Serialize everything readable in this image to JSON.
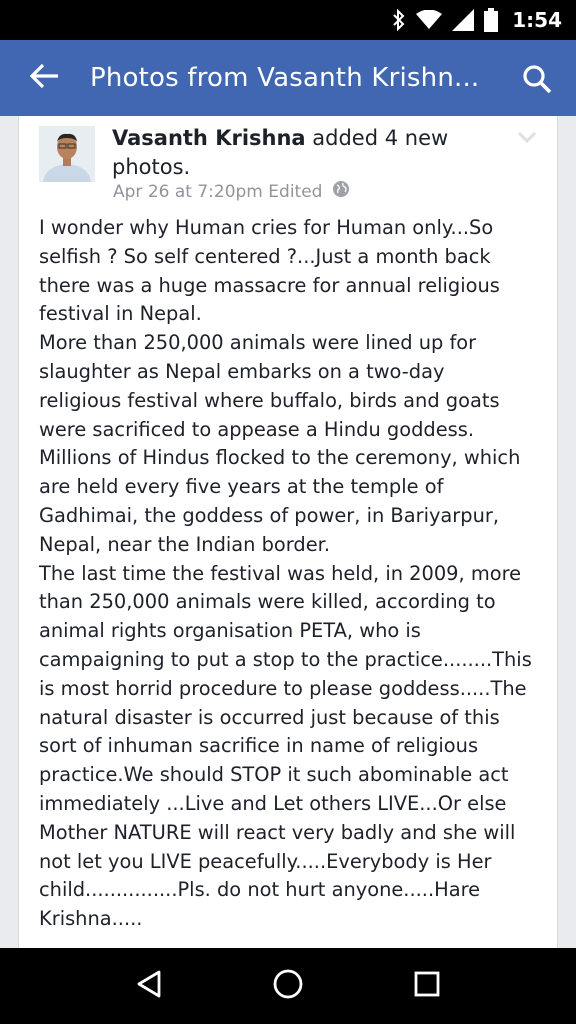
{
  "status_bar": {
    "time": "1:54",
    "icons": [
      "bluetooth-icon",
      "wifi-icon",
      "cell-signal-icon",
      "battery-icon"
    ]
  },
  "app_bar": {
    "title": "Photos from Vasanth Krishn...",
    "back_icon": "arrow-left-icon",
    "search_icon": "search-icon",
    "color": "#4267b2"
  },
  "post": {
    "author": "Vasanth Krishna",
    "action": " added 4 new photos.",
    "timestamp": "Apr 26 at 7:20pm",
    "edited": "Edited",
    "privacy_icon": "globe-icon",
    "body_lines": [
      "I wonder why Human cries for Human only...So",
      "selfish ? So self centered ?...Just a month back",
      "there was a huge massacre for annual religious",
      "festival in Nepal.",
      "More than 250,000 animals were lined up for",
      "slaughter as Nepal embarks on a two-day",
      "religious festival where buffalo, birds and goats",
      "were sacrificed to appease a Hindu goddess.",
      "Millions of Hindus flocked to the ceremony, which",
      "are held every five years at the temple of",
      "Gadhimai, the goddess of power, in Bariyarpur,",
      "Nepal, near the Indian border.",
      "The last time the festival was held, in 2009, more",
      "than 250,000 animals were killed, according to",
      "animal rights organisation PETA, who is",
      "campaigning to put a stop to the practice........This",
      "is most horrid procedure to please goddess.....The",
      "natural disaster is occurred just because of this",
      "sort of inhuman sacrifice in name of religious",
      "practice.We should STOP it such abominable act",
      "immediately ...Live and Let others LIVE...Or else",
      "Mother NATURE will react very badly and she will",
      "not let you LIVE peacefully.....Everybody is Her",
      "child...............Pls. do not hurt anyone.....Hare",
      "Krishna....."
    ]
  },
  "nav_bar": {
    "buttons": [
      "back-triangle-icon",
      "home-circle-icon",
      "recents-square-icon"
    ]
  }
}
